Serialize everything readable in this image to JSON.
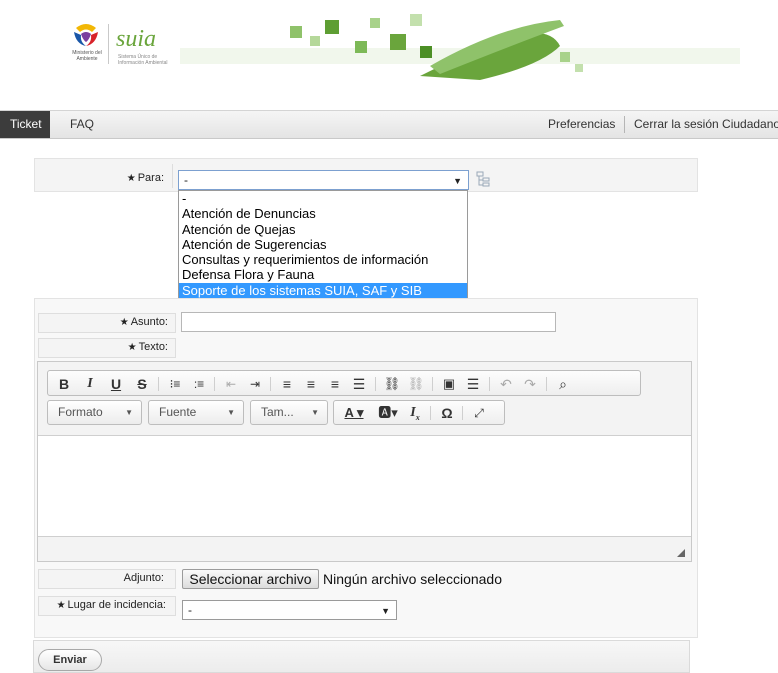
{
  "header": {
    "ministry_text": "Ministerio del Ambiente",
    "suia_text": "suia",
    "suia_small": "Sistema Único de Información Ambiental"
  },
  "nav": {
    "ticket": "Ticket",
    "faq": "FAQ",
    "preferences": "Preferencias",
    "logout": "Cerrar la sesión Ciudadano"
  },
  "form": {
    "para_label": "Para:",
    "para_value": "-",
    "para_options": [
      "-",
      "Atención de Denuncias",
      "Atención de Quejas",
      "Atención de Sugerencias",
      "Consultas y requerimientos de información",
      "Defensa Flora y Fauna",
      "Soporte de los sistemas SUIA, SAF y SIB"
    ],
    "para_selected_index": 6,
    "asunto_label": "Asunto:",
    "asunto_value": "",
    "texto_label": "Texto:",
    "required_mark": "★",
    "editor": {
      "toolbar_row1": [
        "bold-icon",
        "italic-icon",
        "underline-icon",
        "strikethrough-icon",
        "numbered-list-icon",
        "bulleted-list-icon",
        "outdent-icon",
        "indent-icon",
        "align-left-icon",
        "align-center-icon",
        "align-right-icon",
        "justify-icon",
        "link-icon",
        "unlink-icon",
        "image-icon",
        "horizontal-line-icon",
        "undo-icon",
        "redo-icon",
        "find-icon"
      ],
      "format_label": "Formato",
      "font_label": "Fuente",
      "size_label": "Tam...",
      "content": ""
    },
    "adjunto_label": "Adjunto:",
    "file_button": "Seleccionar archivo",
    "file_status": "Ningún archivo seleccionado",
    "lugar_label": "Lugar de incidencia:",
    "lugar_value": "-",
    "submit": "Enviar"
  },
  "colors": {
    "nav_active_bg": "#3c3c3c",
    "selected_option_bg": "#3399ff",
    "select_border": "#7ca0d0"
  }
}
